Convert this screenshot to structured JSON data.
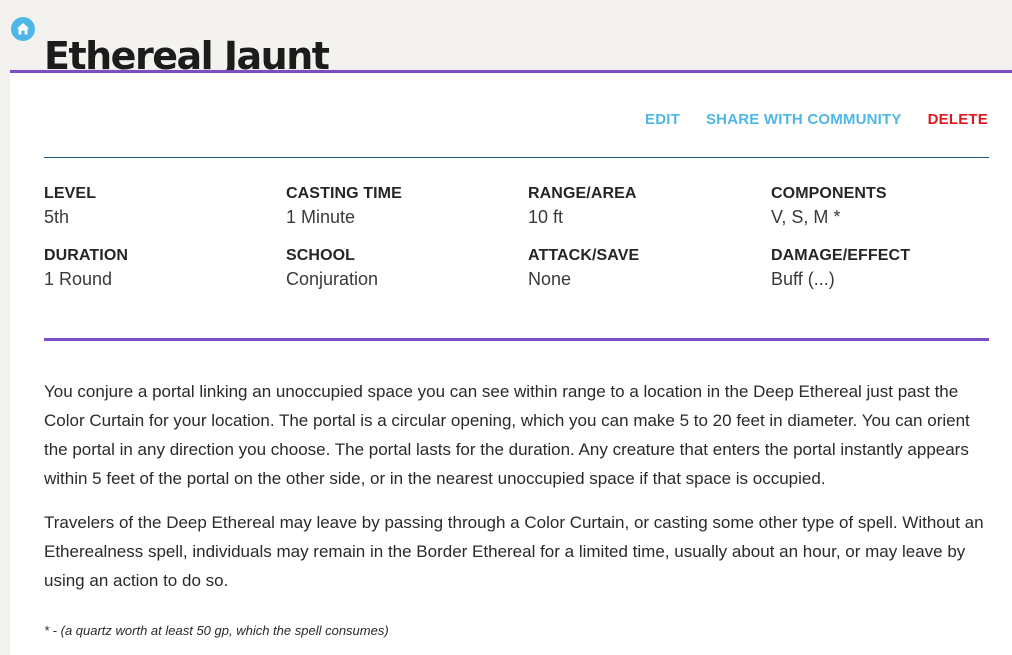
{
  "page": {
    "title": "Ethereal Jaunt",
    "home_icon": "home-icon",
    "accent": "#7b4ec6",
    "link_color": "#4fb7e8",
    "danger_color": "#e0171f"
  },
  "actions": {
    "edit": "EDIT",
    "share": "SHARE WITH COMMUNITY",
    "delete": "DELETE"
  },
  "stats": [
    {
      "label": "LEVEL",
      "value": "5th"
    },
    {
      "label": "CASTING TIME",
      "value": "1 Minute"
    },
    {
      "label": "RANGE/AREA",
      "value": "10 ft"
    },
    {
      "label": "COMPONENTS",
      "value": "V, S, M *"
    },
    {
      "label": "DURATION",
      "value": "1 Round"
    },
    {
      "label": "SCHOOL",
      "value": "Conjuration"
    },
    {
      "label": "ATTACK/SAVE",
      "value": "None"
    },
    {
      "label": "DAMAGE/EFFECT",
      "value": "Buff (...)"
    }
  ],
  "description": [
    "You conjure a portal linking an unoccupied space you can see within range to a location in the Deep Ethereal just past the Color Curtain for your location.  The portal is a circular opening, which you can make 5 to 20 feet in diameter. You can orient the portal in any direction you choose. The portal lasts for the duration.  Any creature that enters the portal instantly appears within 5 feet of the portal on the other side, or in the nearest unoccupied space if that space is occupied.",
    "Travelers of the Deep Ethereal may leave by passing through a Color Curtain, or casting some other type of spell.  Without an Etherealness spell, individuals may remain in the Border Ethereal for a limited time, usually about an hour, or may leave by using an action to do so."
  ],
  "footnote": "* - (a quartz worth at least 50 gp, which the spell consumes)"
}
